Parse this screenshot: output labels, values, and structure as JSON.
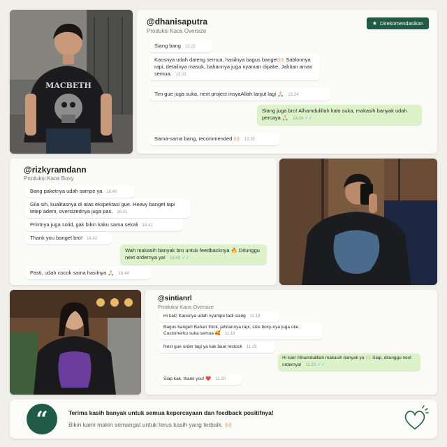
{
  "colors": {
    "brand_green": "#1f5b46",
    "outgoing_bubble": "#dcf2c9",
    "background": "#f1efe9"
  },
  "chat1": {
    "handle": "@dhanisaputra",
    "product": "Produksi Kaos Oversize",
    "badge": "Direkomendasikan",
    "badge_icon": "star-icon",
    "messages": [
      {
        "text": "Siang bang",
        "time": "13.22",
        "direction": "in"
      },
      {
        "text": "Kaosnya udah dateng semua, hasilnya bagus banget🙌🏻 Sablonnya rapi, detailnya masuk, bahannya juga nyaman dipake. Jahitan aman semua.",
        "time": "13.23",
        "direction": "in"
      },
      {
        "text": "Tim gue juga suka, next project insyaAllah lanjut lagi 🙏🏻",
        "time": "13.24",
        "direction": "in"
      },
      {
        "text": "Siang juga bro! Alhamdulillah kalo suka, makasih banyak udah percaya 🙏🏻",
        "time": "13.24",
        "direction": "out"
      },
      {
        "text": "Sama-sama bang, recommended 🙌🏻",
        "time": "13.25",
        "direction": "in"
      }
    ]
  },
  "chat2": {
    "handle": "@rizkyramdann",
    "product": "Produksi Kaos Boxy",
    "messages": [
      {
        "text": "Bang paketnya udah sampe ya",
        "time": "16.40",
        "direction": "in"
      },
      {
        "text": "Gila sih, kualitasnya di atas ekspektasi gue. Heavy banget tapi tetep adem, oversizednya juga pas.",
        "time": "16.41",
        "direction": "in"
      },
      {
        "text": "Printnya juga solid, gak bikin kaku sama sekali",
        "time": "16.41",
        "direction": "in"
      },
      {
        "text": "Thank you banget bro!",
        "time": "16.42",
        "direction": "in"
      },
      {
        "text": "Wah makasih banyak bro untuk feedbacknya 🔥 Ditunggu next ordernya ya!",
        "time": "16.43",
        "direction": "out"
      },
      {
        "text": "Pasti, udah cocok sama hasilnya 🙏🏻",
        "time": "16.44",
        "direction": "in"
      }
    ]
  },
  "chat3": {
    "handle": "@sintianrl",
    "product": "Produksi Kaos Oversize",
    "messages": [
      {
        "text": "Hi kak! Kaosnya udah nyampe tadi siang",
        "time": "11.18",
        "direction": "in"
      },
      {
        "text": "Bagus banget! Bahan thick, jahitannya rapi, size boxy-nya juga oke. Customerku suka semua 🥰",
        "time": "11.19",
        "direction": "in"
      },
      {
        "text": "Next gue order lagi ya kak buat restock",
        "time": "11.19",
        "direction": "in"
      },
      {
        "text": "Hi kak! Alhamdulillah makasih banyak ya 🙌🏻 Siap, ditunggu next ordernya!",
        "time": "11.20",
        "direction": "out"
      },
      {
        "text": "Siap kak, thank you! ❤️",
        "time": "11.20",
        "direction": "in"
      }
    ]
  },
  "photos": {
    "photo1_shirt_text": "MACBETH"
  },
  "footer": {
    "icon": "quote-icon",
    "title": "Terima kasih banyak untuk semua kepercayaan dan feedback positifnya!",
    "subtitle": "Bikin kami makin semangat untuk terus kasih yang terbaik. 🙌🏻",
    "decor_icon": "heart-icon"
  }
}
